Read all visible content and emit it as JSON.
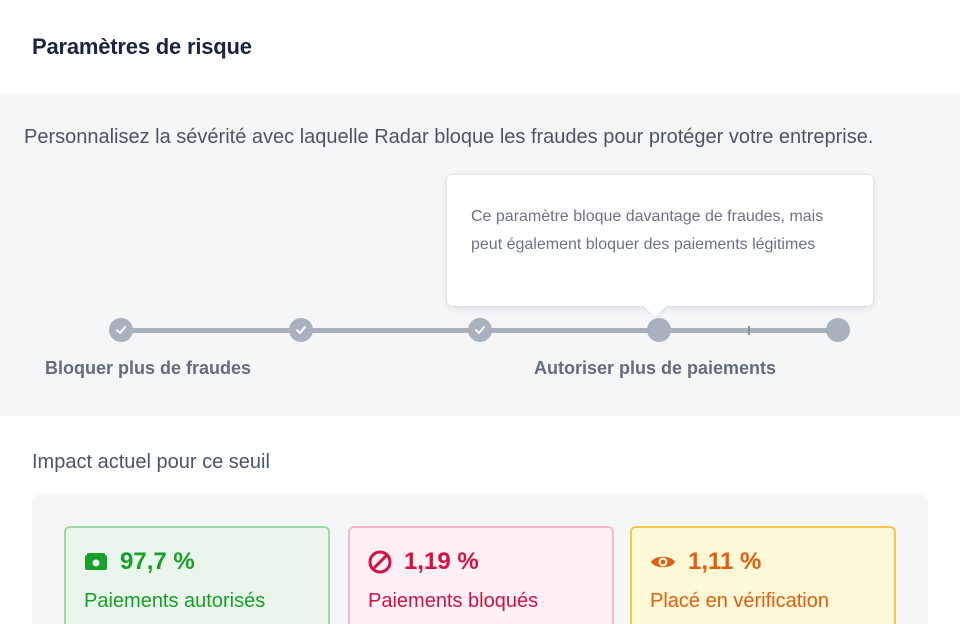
{
  "page": {
    "title": "Paramètres de risque"
  },
  "risk": {
    "description": "Personnalisez la sévérité avec laquelle Radar bloque les fraudes pour protéger votre entreprise.",
    "tooltip": "Ce paramètre bloque davantage de fraudes, mais peut également bloquer des paiements légitimes",
    "label_left": "Bloquer plus de fraudes",
    "label_right": "Autoriser plus de paiements",
    "selected_step": 4,
    "total_steps": 5
  },
  "impact": {
    "heading": "Impact actuel pour ce seuil",
    "cards": [
      {
        "value": "97,7 %",
        "label": "Paiements autorisés",
        "icon": "cash-icon",
        "color": "#16a02b"
      },
      {
        "value": "1,19 %",
        "label": "Paiements bloqués",
        "icon": "blocked-icon",
        "color": "#d6113f"
      },
      {
        "value": "1,11 %",
        "label": "Placé en vérification",
        "icon": "eye-icon",
        "color": "#e35d0f"
      }
    ]
  }
}
